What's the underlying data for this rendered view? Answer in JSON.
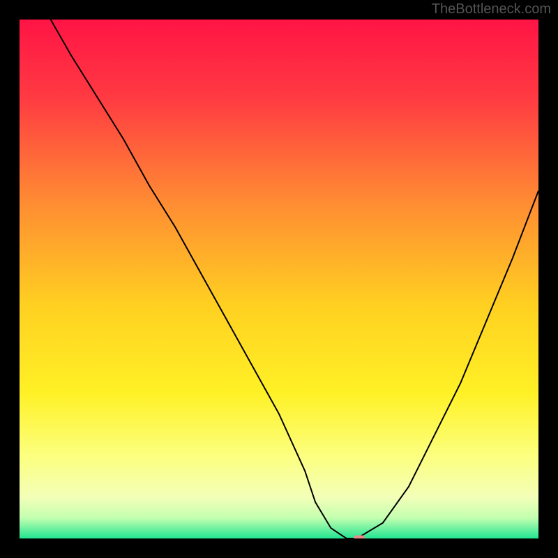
{
  "watermark": "TheBottleneck.com",
  "chart_data": {
    "type": "line",
    "title": "",
    "xlabel": "",
    "ylabel": "",
    "xlim": [
      0,
      100
    ],
    "ylim": [
      0,
      100
    ],
    "curve": {
      "name": "bottleneck-curve",
      "x": [
        6,
        10,
        15,
        20,
        25,
        30,
        35,
        40,
        45,
        50,
        55,
        57,
        60,
        63,
        65,
        70,
        75,
        80,
        85,
        90,
        95,
        100
      ],
      "y": [
        100,
        93,
        85,
        77,
        68,
        60,
        51,
        42,
        33,
        24,
        13,
        7,
        2,
        0,
        0,
        3,
        10,
        20,
        30,
        42,
        54,
        67
      ]
    },
    "marker": {
      "x": 65.5,
      "y": 0,
      "color": "#e88a8a",
      "width": 2.2,
      "height": 1.2
    },
    "background": {
      "type": "vertical-gradient",
      "stops": [
        {
          "offset": 0.0,
          "color": "#ff1445"
        },
        {
          "offset": 0.15,
          "color": "#ff3a42"
        },
        {
          "offset": 0.35,
          "color": "#ff8b33"
        },
        {
          "offset": 0.55,
          "color": "#ffd021"
        },
        {
          "offset": 0.72,
          "color": "#fff126"
        },
        {
          "offset": 0.84,
          "color": "#fcff7e"
        },
        {
          "offset": 0.92,
          "color": "#f3ffb8"
        },
        {
          "offset": 0.96,
          "color": "#c4ffb0"
        },
        {
          "offset": 1.0,
          "color": "#21e592"
        }
      ]
    }
  }
}
